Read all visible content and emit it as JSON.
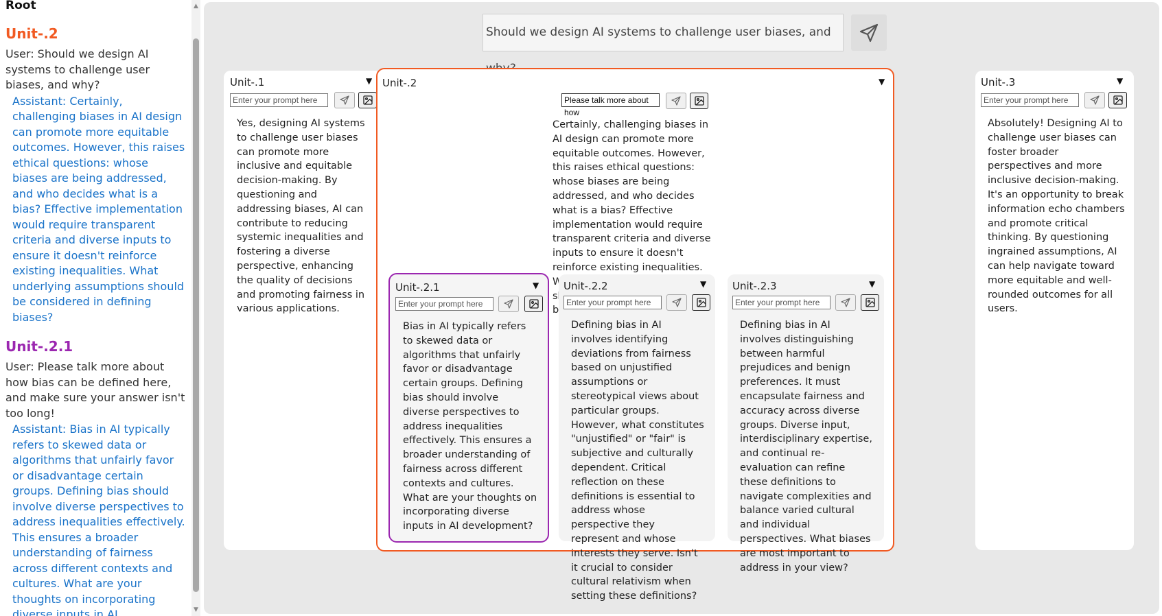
{
  "sidebar": {
    "root_label": "Root",
    "sections": [
      {
        "title": "Unit-.2",
        "color": "#f15a22",
        "user": "User: Should we design AI systems to challenge user biases, and why?",
        "assistant": "Assistant: Certainly, challenging biases in AI design can promote more equitable outcomes. However, this raises ethical questions: whose biases are being addressed, and who decides what is a bias? Effective implementation would require transparent criteria and diverse inputs to ensure it doesn't reinforce existing inequalities. What underlying assumptions should be considered in defining biases?"
      },
      {
        "title": "Unit-.2.1",
        "color": "#9b27b0",
        "user": "User: Please talk more about how bias can be defined here, and make sure your answer isn't too long!",
        "assistant": "Assistant: Bias in AI typically refers to skewed data or algorithms that unfairly favor or disadvantage certain groups. Defining bias should involve diverse perspectives to address inequalities effectively. This ensures a broader understanding of fairness across different contexts and cultures. What are your thoughts on incorporating diverse inputs in AI development?"
      }
    ]
  },
  "top": {
    "prompt": "Should we design AI systems to challenge user biases, and why?"
  },
  "units": {
    "u1": {
      "title": "Unit-.1",
      "placeholder": "Enter your prompt here",
      "text": "Yes, designing AI systems to challenge user biases can promote more inclusive and equitable decision-making. By questioning and addressing biases, AI can contribute to reducing systemic inequalities and fostering a diverse perspective, enhancing the quality of decisions and promoting fairness in various applications."
    },
    "u2": {
      "title": "Unit-.2",
      "prompt_value": "Please talk more about how",
      "text": "Certainly, challenging biases in AI design can promote more equitable outcomes. However, this raises ethical questions: whose biases are being addressed, and who decides what is a bias? Effective implementation would require transparent criteria and diverse inputs to ensure it doesn't reinforce existing inequalities. What underlying assumptions should be considered in defining biases?"
    },
    "u3": {
      "title": "Unit-.3",
      "placeholder": "Enter your prompt here",
      "text": "Absolutely! Designing AI to challenge user biases can foster broader perspectives and more inclusive decision-making. It's an opportunity to break information echo chambers and promote critical thinking. By questioning ingrained assumptions, AI can help navigate toward more equitable and well-rounded outcomes for all users."
    },
    "u21": {
      "title": "Unit-.2.1",
      "placeholder": "Enter your prompt here",
      "text": "Bias in AI typically refers to skewed data or algorithms that unfairly favor or disadvantage certain groups. Defining bias should involve diverse perspectives to address inequalities effectively. This ensures a broader understanding of fairness across different contexts and cultures. What are your thoughts on incorporating diverse inputs in AI development?"
    },
    "u22": {
      "title": "Unit-.2.2",
      "placeholder": "Enter your prompt here",
      "text": "Defining bias in AI involves identifying deviations from fairness based on unjustified assumptions or stereotypical views about particular groups. However, what constitutes \"unjustified\" or \"fair\" is subjective and culturally dependent. Critical reflection on these definitions is essential to address whose perspective they represent and whose interests they serve. Isn't it crucial to consider cultural relativism when setting these definitions?"
    },
    "u23": {
      "title": "Unit-.2.3",
      "placeholder": "Enter your prompt here",
      "text": "Defining bias in AI involves distinguishing between harmful prejudices and benign preferences. It must encapsulate fairness and accuracy across diverse groups. Diverse input, interdisciplinary expertise, and continual re-evaluation can refine these definitions to navigate complexities and balance varied cultural and individual perspectives. What biases are most important to address in your view?"
    }
  },
  "colors": {
    "active_unit_border": "#f15a22",
    "selected_child_border": "#9b27b0",
    "assistant_text": "#1a73c9"
  },
  "icons": {
    "send": "paper-plane-icon",
    "image": "image-icon",
    "dropdown": "caret-down-icon"
  }
}
